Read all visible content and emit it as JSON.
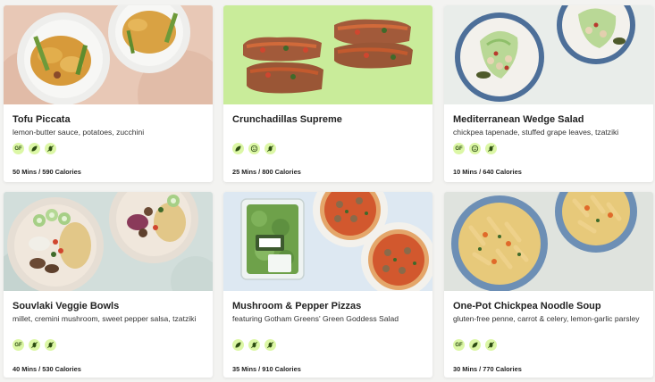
{
  "recipes": [
    {
      "title": "Tofu Piccata",
      "description": "lemon-butter sauce, potatoes, zucchini",
      "meta": "50 Mins / 590 Calories",
      "badges": [
        {
          "icon": "gluten-free-icon",
          "text": "GF"
        },
        {
          "icon": "vegan-leaf-icon",
          "text": ""
        },
        {
          "icon": "no-nuts-icon",
          "text": ""
        }
      ]
    },
    {
      "title": "Crunchadillas Supreme",
      "description": "",
      "meta": "25 Mins / 800 Calories",
      "badges": [
        {
          "icon": "vegan-leaf-icon",
          "text": ""
        },
        {
          "icon": "kid-friendly-icon",
          "text": ""
        },
        {
          "icon": "no-nuts-icon",
          "text": ""
        }
      ]
    },
    {
      "title": "Mediterranean Wedge Salad",
      "description": "chickpea tapenade, stuffed grape leaves, tzatziki",
      "meta": "10 Mins / 640 Calories",
      "badges": [
        {
          "icon": "gluten-free-icon",
          "text": "GF"
        },
        {
          "icon": "kid-friendly-icon",
          "text": ""
        },
        {
          "icon": "no-nuts-icon",
          "text": ""
        }
      ]
    },
    {
      "title": "Souvlaki Veggie Bowls",
      "description": "millet, cremini mushroom, sweet pepper salsa, tzatziki",
      "meta": "40 Mins / 530 Calories",
      "badges": [
        {
          "icon": "gluten-free-icon",
          "text": "GF"
        },
        {
          "icon": "no-nuts-icon",
          "text": ""
        },
        {
          "icon": "no-nuts-icon",
          "text": ""
        }
      ]
    },
    {
      "title": "Mushroom & Pepper Pizzas",
      "description": "featuring Gotham Greens' Green Goddess Salad",
      "meta": "35 Mins / 910 Calories",
      "badges": [
        {
          "icon": "vegan-leaf-icon",
          "text": ""
        },
        {
          "icon": "no-nuts-icon",
          "text": ""
        },
        {
          "icon": "no-nuts-icon",
          "text": ""
        }
      ]
    },
    {
      "title": "One-Pot Chickpea Noodle Soup",
      "description": "gluten-free penne, carrot & celery, lemon-garlic parsley",
      "meta": "30 Mins / 770 Calories",
      "badges": [
        {
          "icon": "gluten-free-icon",
          "text": "GF"
        },
        {
          "icon": "vegan-leaf-icon",
          "text": ""
        },
        {
          "icon": "no-nuts-icon",
          "text": ""
        }
      ]
    }
  ],
  "colors": {
    "badge_bg": "#dcf7a6",
    "badge_fg": "#2d4d12",
    "page_bg": "#f3f3f1"
  }
}
